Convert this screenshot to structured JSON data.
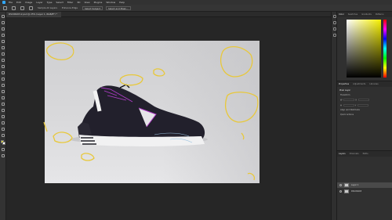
{
  "app": {
    "menu": [
      "File",
      "Edit",
      "Image",
      "Layer",
      "Type",
      "Select",
      "Filter",
      "3D",
      "View",
      "Plugins",
      "Window",
      "Help"
    ]
  },
  "options_bar": {
    "labels": [
      "Sample All Layers",
      "Enhance Edge"
    ],
    "buttons": [
      "Select Subject",
      "Select and Mask..."
    ]
  },
  "document": {
    "tab_title": "DSC06203-2.psd @ 25% (Layer 1, RGB/8*) *"
  },
  "right_panel": {
    "top_tabs": [
      "Color",
      "Swatches",
      "Gradients",
      "Patterns"
    ],
    "properties_tabs": [
      "Properties",
      "Adjustments",
      "Libraries"
    ],
    "properties_title": "Pixel Layer",
    "transform_label": "Transform",
    "w_label": "W",
    "h_label": "H",
    "x_label": "X",
    "y_label": "Y",
    "align_label": "Align and Distribute",
    "quick_actions": "Quick Actions",
    "layers_tabs": [
      "Layers",
      "Channels",
      "Paths"
    ],
    "layers": [
      {
        "name": "Layer 1",
        "selected": true
      },
      {
        "name": "DSC06203",
        "selected": false
      }
    ]
  },
  "colors": {
    "foreground": "#e8e03a",
    "background": "#ffffff",
    "overlay": "#e8c83a",
    "accent_purple": "#b03cc8"
  }
}
